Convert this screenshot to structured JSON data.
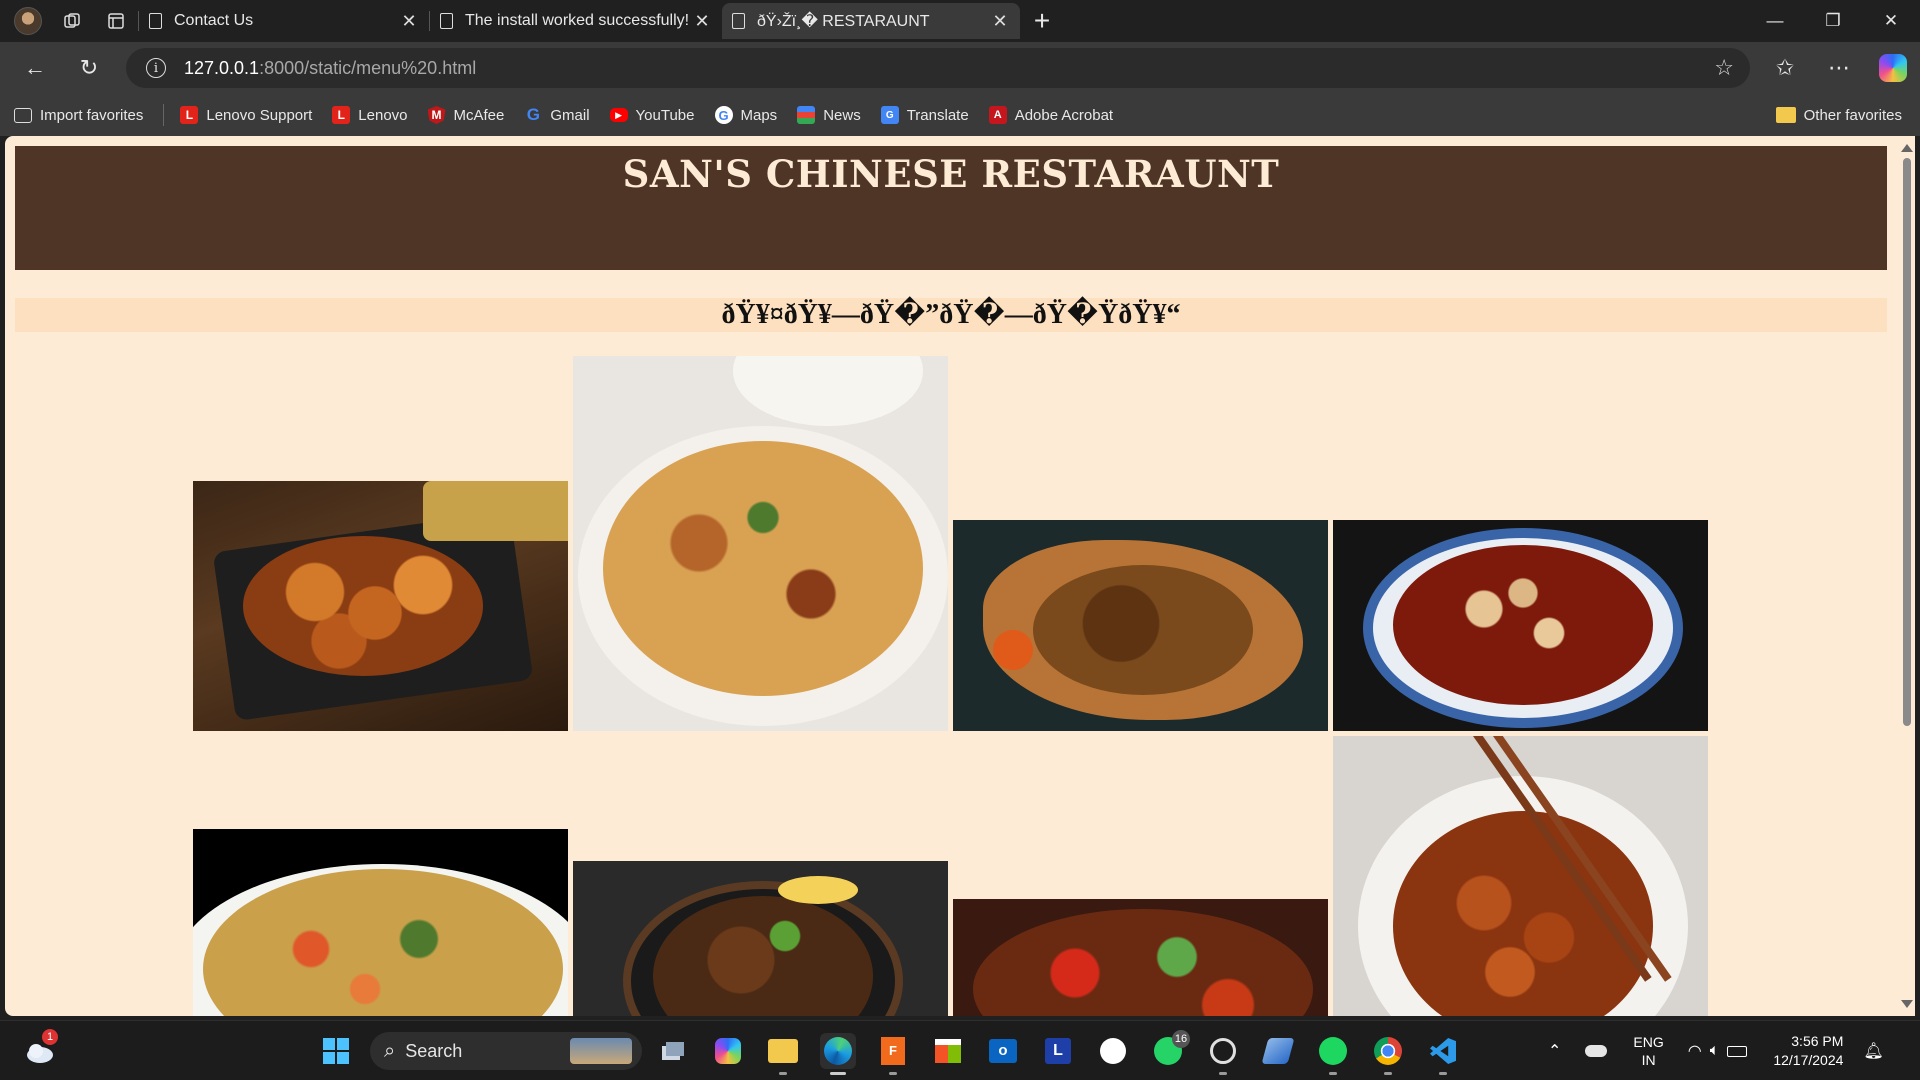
{
  "browser": {
    "tabs": [
      {
        "title": "Contact Us",
        "active": false
      },
      {
        "title": "The install worked successfully! Co",
        "active": false
      },
      {
        "title": "ðŸ›Žï¸� RESTARAUNT",
        "active": true
      }
    ],
    "url_host": "127.0.0.1",
    "url_rest": ":8000/static/menu%20.html",
    "favorites": [
      {
        "label": "Import favorites",
        "icon": "import-icon"
      },
      {
        "label": "Lenovo Support",
        "icon": "lenovo-icon"
      },
      {
        "label": "Lenovo",
        "icon": "lenovo-icon"
      },
      {
        "label": "McAfee",
        "icon": "mcafee-icon"
      },
      {
        "label": "Gmail",
        "icon": "google-icon"
      },
      {
        "label": "YouTube",
        "icon": "youtube-icon"
      },
      {
        "label": "Maps",
        "icon": "google-icon"
      },
      {
        "label": "News",
        "icon": "news-icon"
      },
      {
        "label": "Translate",
        "icon": "translate-icon"
      },
      {
        "label": "Adobe Acrobat",
        "icon": "acrobat-icon"
      }
    ],
    "other_favorites": "Other favorites"
  },
  "page": {
    "title": "SAN'S CHINESE RESTARAUNT",
    "menu_heading": "ðŸ¥¤ðŸ¥—ðŸ�”ðŸ�—ðŸ�ŸðŸ¥“",
    "colors": {
      "header_bg": "#4e3526",
      "page_bg": "#fdebd6",
      "menu_bar_bg": "#fde0bf"
    },
    "dishes": [
      {
        "name": "orange-chicken-dish"
      },
      {
        "name": "biryani-dish"
      },
      {
        "name": "noodles-board-dish"
      },
      {
        "name": "mapo-tofu-dish"
      },
      {
        "name": "veg-hakka-noodles-dish"
      },
      {
        "name": "sizzler-dish"
      },
      {
        "name": "chilli-chicken-dish"
      },
      {
        "name": "sesame-chicken-bowl-dish"
      }
    ]
  },
  "taskbar": {
    "search_label": "Search",
    "whatsapp_badge": "16",
    "weather_badge": "1",
    "lang_top": "ENG",
    "lang_bottom": "IN",
    "time": "3:56 PM",
    "date": "12/17/2024"
  }
}
